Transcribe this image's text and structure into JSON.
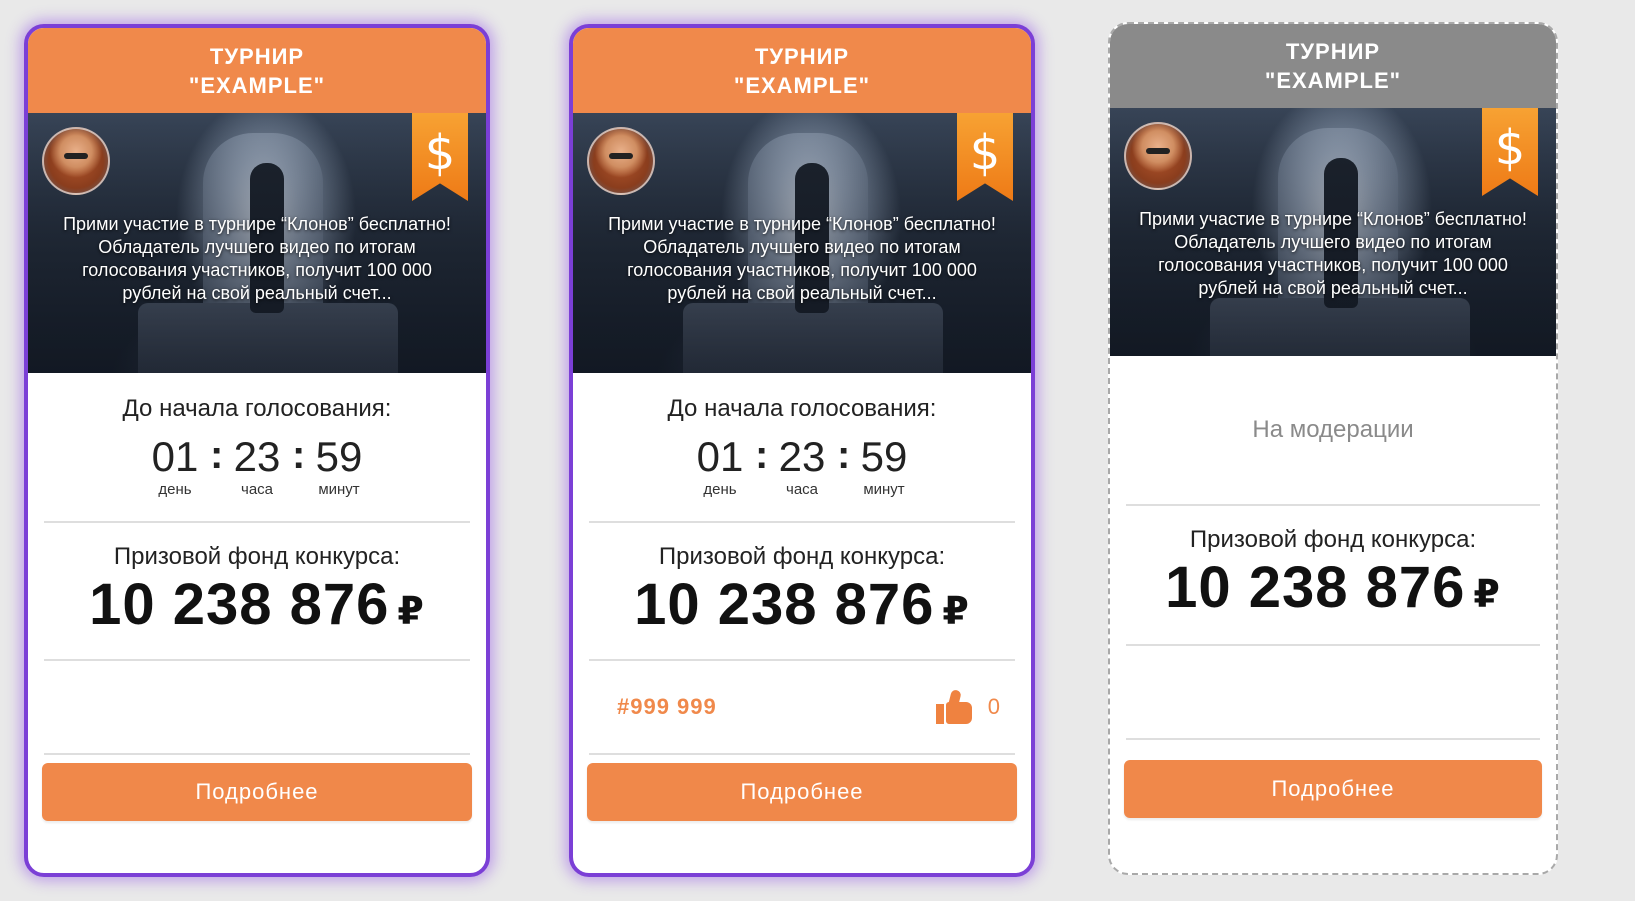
{
  "cards": [
    {
      "header_line1": "ТУРНИР",
      "header_line2": "\"EXAMPLE\"",
      "description": "Прими участие в турнире “Клонов” бесплатно! Обладатель лучшего видео по итогам голосования участников, получит 100 000 рублей на свой реальный счет...",
      "ribbon_symbol": "$",
      "countdown_label": "До начала голосования:",
      "days": "01",
      "days_caption": "день",
      "hours": "23",
      "hours_caption": "часа",
      "minutes": "59",
      "minutes_caption": "минут",
      "prize_label": "Призовой фонд конкурса:",
      "prize_value": "10 238 876",
      "currency": "₽",
      "button_label": "Подробнее",
      "state": "selected"
    },
    {
      "header_line1": "ТУРНИР",
      "header_line2": "\"EXAMPLE\"",
      "description": "Прими участие в турнире “Клонов” бесплатно! Обладатель лучшего видео по итогам голосования участников, получит 100 000 рублей на свой реальный счет...",
      "ribbon_symbol": "$",
      "countdown_label": "До начала голосования:",
      "days": "01",
      "days_caption": "день",
      "hours": "23",
      "hours_caption": "часа",
      "minutes": "59",
      "minutes_caption": "минут",
      "prize_label": "Призовой фонд конкурса:",
      "prize_value": "10 238 876",
      "currency": "₽",
      "entry_number": "#999 999",
      "likes": "0",
      "button_label": "Подробнее",
      "state": "selected"
    },
    {
      "header_line1": "ТУРНИР",
      "header_line2": "\"EXAMPLE\"",
      "description": "Прими участие в турнире “Клонов” бесплатно! Обладатель лучшего видео по итогам голосования участников, получит 100 000 рублей на свой реальный счет...",
      "ribbon_symbol": "$",
      "status_text": "На модерации",
      "prize_label": "Призовой фонд конкурса:",
      "prize_value": "10 238 876",
      "currency": "₽",
      "button_label": "Подробнее",
      "state": "pending"
    }
  ],
  "colors": {
    "accent": "#f0894b",
    "selected_border": "#7b3fd6",
    "pending_header": "#8a8a8a"
  },
  "icons": {
    "ribbon": "dollar-ribbon-icon",
    "like": "thumbs-up-icon"
  }
}
